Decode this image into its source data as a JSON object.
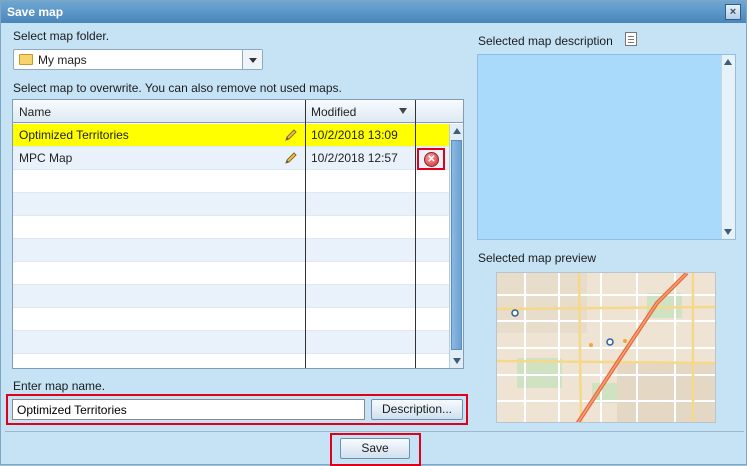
{
  "window": {
    "title": "Save map",
    "close_glyph": "×"
  },
  "folder": {
    "label": "Select map folder.",
    "selected": "My maps",
    "icon": "folder-icon"
  },
  "maps": {
    "instruction": "Select map to overwrite. You can also remove not used maps.",
    "columns": {
      "name": "Name",
      "modified": "Modified"
    },
    "rows": [
      {
        "name": "Optimized Territories",
        "modified": "10/2/2018 13:09",
        "selected": true
      },
      {
        "name": "MPC Map",
        "modified": "10/2/2018 12:57",
        "selected": false
      }
    ],
    "delete_glyph": "✕"
  },
  "name_entry": {
    "label": "Enter map name.",
    "value": "Optimized Territories",
    "description_button": "Description..."
  },
  "description": {
    "label": "Selected map description"
  },
  "preview": {
    "label": "Selected map preview"
  },
  "save_button": "Save",
  "colors": {
    "selected_row": "#ffff00",
    "highlight": "#e0001a",
    "desc_bg": "#a9d9fb",
    "title_bar": "#4a86bb"
  }
}
